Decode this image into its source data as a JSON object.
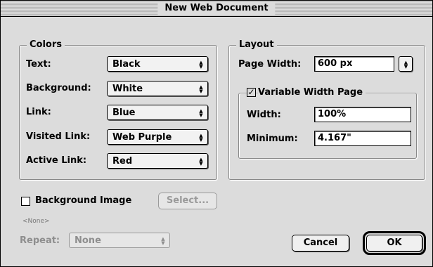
{
  "window": {
    "title": "New Web Document"
  },
  "colors": {
    "group_title": "Colors",
    "text": {
      "label": "Text:",
      "value": "Black"
    },
    "background": {
      "label": "Background:",
      "value": "White"
    },
    "link": {
      "label": "Link:",
      "value": "Blue"
    },
    "visited_link": {
      "label": "Visited Link:",
      "value": "Web Purple"
    },
    "active_link": {
      "label": "Active Link:",
      "value": "Red"
    }
  },
  "layout": {
    "group_title": "Layout",
    "page_width_label": "Page Width:",
    "page_width_value": "600 px",
    "variable_width": {
      "checkbox_label": "Variable Width Page",
      "checked": true,
      "width_label": "Width:",
      "width_value": "100%",
      "minimum_label": "Minimum:",
      "minimum_value": "4.167\""
    }
  },
  "background_image": {
    "checkbox_label": "Background Image",
    "checked": false,
    "select_button": "Select...",
    "none_text": "<None>",
    "repeat_label": "Repeat:",
    "repeat_value": "None"
  },
  "buttons": {
    "cancel": "Cancel",
    "ok": "OK"
  },
  "icons": {
    "popup_arrows": "up-down-arrows-icon",
    "check": "checkmark-icon"
  }
}
